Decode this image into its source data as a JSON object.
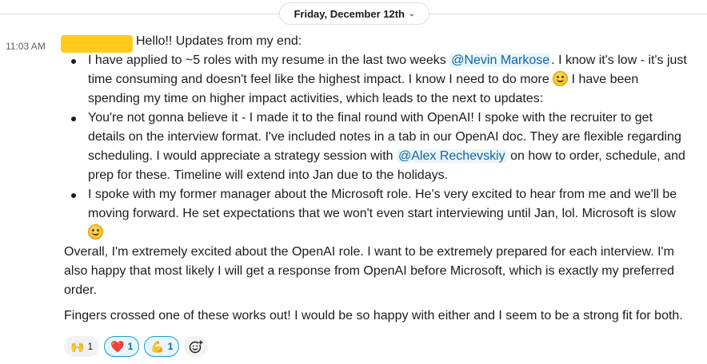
{
  "date_divider": {
    "label": "Friday, December 12th",
    "chevron": "chevron-down-icon"
  },
  "message": {
    "time": "11:03 AM",
    "intro": "Hello!! Updates from my end:",
    "b1": {
      "l1a": "I have applied to ~5 roles with my resume in the last two weeks ",
      "mention": "@Nevin Markose",
      "l1b": ". I know it's low - it's just",
      "l2a": "time consuming and doesn't feel like the highest impact. I know I need to do more ",
      "l2b": " I have been",
      "l3": "spending my time on higher impact activities, which leads to the next to updates:"
    },
    "b2": {
      "l1": "You're not gonna believe it - I made it to the final round with OpenAI! I spoke with the recruiter to get",
      "l2": "details on the interview format. I've included notes in a tab in our OpenAI doc. They are flexible regarding",
      "l3a": "scheduling. I would appreciate a strategy session with ",
      "mention": "@Alex Rechevskiy",
      "l3b": " on how to order, schedule, and",
      "l4": "prep for these. Timeline will extend into Jan due to the holidays."
    },
    "b3": {
      "l1": "I spoke with my former manager about the Microsoft role. He's very excited to hear from me and we'll be",
      "l2": "moving forward. He set expectations that we won't even start interviewing until Jan, lol. Microsoft is slow"
    },
    "p1": {
      "l1": "Overall, I'm extremely excited about the OpenAI role. I want to be extremely prepared for each interview. I'm",
      "l2": "also happy that most likely I will get a response from OpenAI before Microsoft, which is exactly my preferred",
      "l3": "order."
    },
    "p2": "Fingers crossed one of these works out! I would be so happy with either and I seem to be a strong fit for both.",
    "emoji_icon": "slightly-smiling-face-icon"
  },
  "reactions": [
    {
      "emoji": "🙌",
      "icon": "raised-hands-icon",
      "count": "1",
      "active": false
    },
    {
      "emoji": "❤️",
      "icon": "heart-icon",
      "count": "1",
      "active": true
    },
    {
      "emoji": "💪",
      "icon": "flexed-biceps-icon",
      "count": "1",
      "active": true
    }
  ],
  "add_reaction_icon": "add-reaction-icon",
  "colors": {
    "mention": "#1264a3",
    "mention_bg": "#e8f5fa",
    "redaction": "#ffca1c",
    "active_reaction_border": "#1d9bd1"
  }
}
